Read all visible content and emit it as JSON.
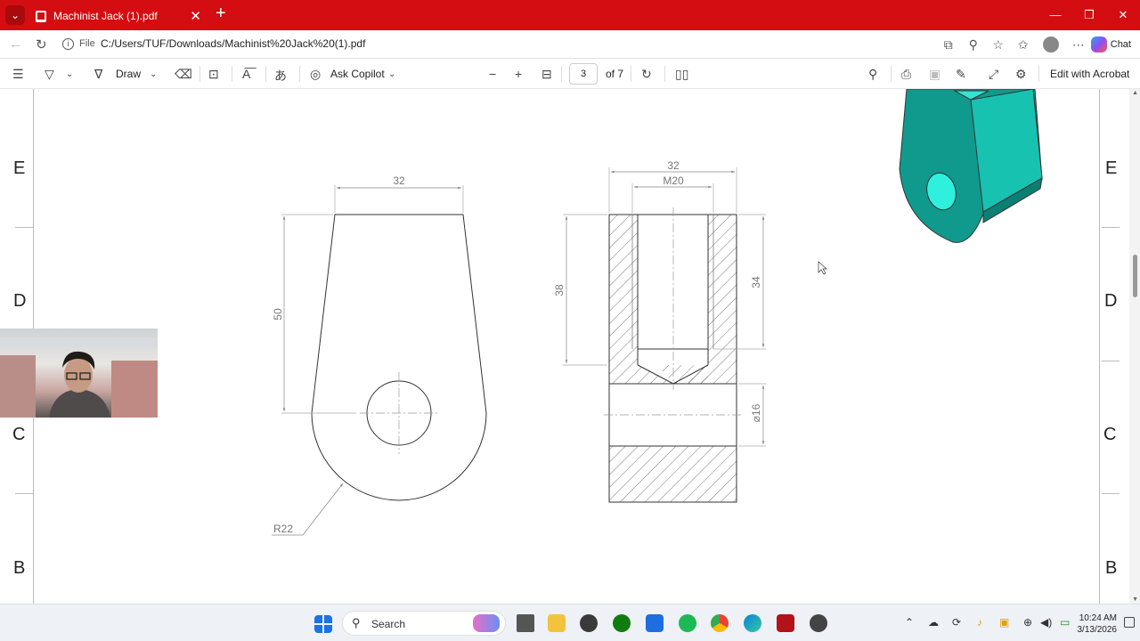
{
  "browser": {
    "tab_title": "Machinist Jack (1).pdf",
    "new_tab": "+",
    "file_label": "File",
    "url": "C:/Users/TUF/Downloads/Machinist%20Jack%20(1).pdf",
    "chat_label": "Chat"
  },
  "pdf_toolbar": {
    "draw_label": "Draw",
    "ask_copilot_label": "Ask Copilot",
    "page_current": "3",
    "page_total": "of 7",
    "edit_with_acrobat_label": "Edit with Acrobat"
  },
  "drawing": {
    "zone_labels_left": [
      "E",
      "D",
      "C",
      "B"
    ],
    "zone_labels_right": [
      "E",
      "D",
      "C",
      "B"
    ],
    "front_view": {
      "width_dim": "32",
      "height_dim": "50",
      "radius_dim": "R22"
    },
    "section_view": {
      "width_dim": "32",
      "thread_dim": "M20",
      "depth_dim": "38",
      "thread_depth_dim": "34",
      "hole_dim": "⌀16"
    },
    "model_color": "#11a99a"
  },
  "taskbar": {
    "search_label": "Search",
    "time": "10:24 AM",
    "date": "3/13/2026"
  },
  "colors": {
    "tab_bar": "#d40d12",
    "taskbar": "#eef1f6"
  }
}
